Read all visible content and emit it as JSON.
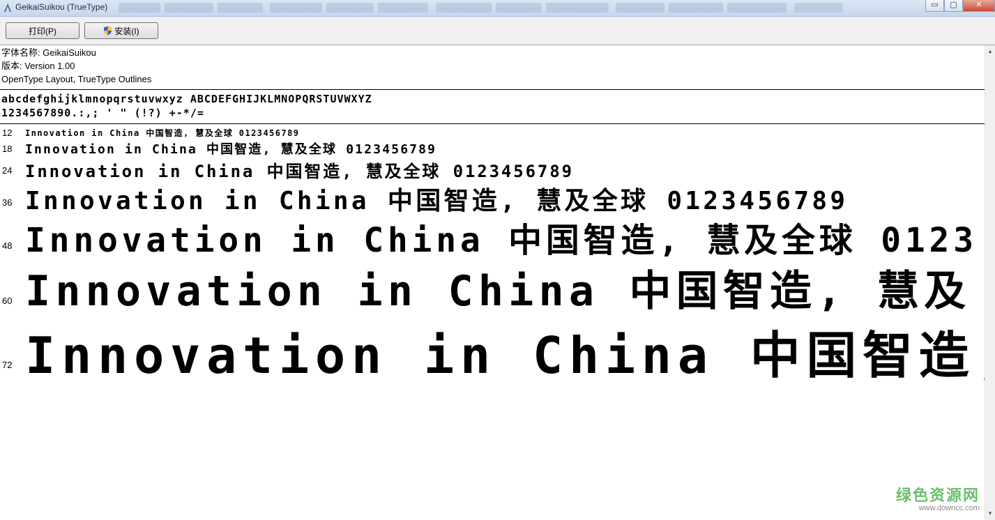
{
  "window": {
    "title": "GeikaiSuikou (TrueType)",
    "controls": [
      "▭",
      "▢",
      "✕"
    ]
  },
  "toolbar": {
    "print_label": "打印(P)",
    "install_label": "安装(I)"
  },
  "font_info": {
    "name_line": "字体名称: GeikaiSuikou",
    "version_line": "版本: Version 1.00",
    "type_line": "OpenType Layout, TrueType Outlines"
  },
  "charset": {
    "letters": "abcdefghijklmnopqrstuvwxyz ABCDEFGHIJKLMNOPQRSTUVWXYZ",
    "digits": "1234567890.:,; ' \" (!?) +-*/="
  },
  "samples": [
    {
      "size": "12",
      "text": "Innovation in China 中国智造, 慧及全球 0123456789"
    },
    {
      "size": "18",
      "text": "Innovation in China 中国智造, 慧及全球 0123456789"
    },
    {
      "size": "24",
      "text": "Innovation in China 中国智造, 慧及全球 0123456789"
    },
    {
      "size": "36",
      "text": "Innovation in China 中国智造, 慧及全球 0123456789"
    },
    {
      "size": "48",
      "text": "Innovation in China 中国智造, 慧及全球 0123"
    },
    {
      "size": "60",
      "text": "Innovation in China 中国智造, 慧及"
    },
    {
      "size": "72",
      "text": "Innovation in China 中国智造,"
    }
  ],
  "watermark": {
    "text": "绿色资源网",
    "url": "www.downcc.com"
  },
  "colors": {
    "titlebar": "#c7d7ec",
    "toolbar": "#f0f0f0",
    "watermark": "#6bbf6b"
  }
}
